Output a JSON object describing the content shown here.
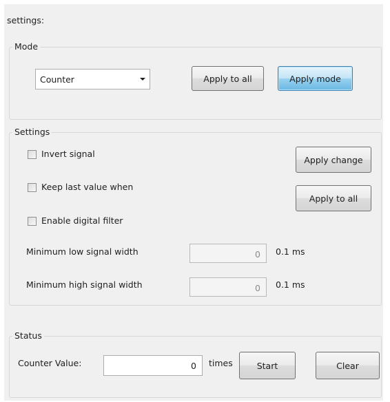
{
  "title": "settings:",
  "mode_group": {
    "legend": "Mode",
    "combo_value": "Counter",
    "apply_all_label": "Apply to all",
    "apply_mode_label": "Apply mode"
  },
  "settings_group": {
    "legend": "Settings",
    "invert_label": "Invert signal",
    "invert_checked": false,
    "keep_label": "Keep last value when",
    "keep_checked": false,
    "filter_label": "Enable digital filter",
    "filter_checked": false,
    "apply_change_label": "Apply change",
    "apply_all_label": "Apply to all",
    "min_low_label": "Minimum low signal width",
    "min_low_value": "0",
    "min_low_unit": "0.1 ms",
    "min_high_label": "Minimum high signal width",
    "min_high_value": "0",
    "min_high_unit": "0.1 ms"
  },
  "status_group": {
    "legend": "Status",
    "counter_label": "Counter Value:",
    "counter_value": "0",
    "counter_unit": "times",
    "start_label": "Start",
    "clear_label": "Clear"
  }
}
